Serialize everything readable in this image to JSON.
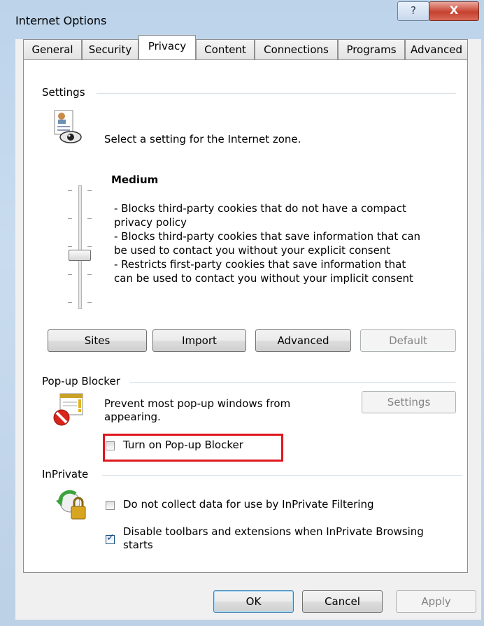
{
  "window": {
    "title": "Internet Options",
    "help_label": "?",
    "close_label": "X"
  },
  "tabs": [
    {
      "label": "General"
    },
    {
      "label": "Security"
    },
    {
      "label": "Privacy"
    },
    {
      "label": "Content"
    },
    {
      "label": "Connections"
    },
    {
      "label": "Programs"
    },
    {
      "label": "Advanced"
    }
  ],
  "active_tab": "Privacy",
  "settings": {
    "group_label": "Settings",
    "zone_text": "Select a setting for the Internet zone.",
    "level_title": "Medium",
    "level_lines": [
      "- Blocks third-party cookies that do not have a compact",
      "privacy policy",
      "- Blocks third-party cookies that save information that can",
      "be used to contact you without your explicit consent",
      "- Restricts first-party cookies that save information that",
      "can be used to contact you without your implicit consent"
    ],
    "buttons": {
      "sites": "Sites",
      "import": "Import",
      "advanced": "Advanced",
      "default": "Default"
    },
    "icon": "privacy-eye-icon"
  },
  "popup_blocker": {
    "group_label": "Pop-up Blocker",
    "description_line1": "Prevent most pop-up windows from",
    "description_line2": "appearing.",
    "settings_button": "Settings",
    "checkbox_label": "Turn on Pop-up Blocker",
    "checked": false,
    "icon": "popup-blocked-icon"
  },
  "inprivate": {
    "group_label": "InPrivate",
    "option1_label": "Do not collect data for use by InPrivate Filtering",
    "option1_checked": false,
    "option2_line1": "Disable toolbars and extensions when InPrivate Browsing",
    "option2_line2": "starts",
    "option2_checked": true,
    "icon": "inprivate-lock-icon"
  },
  "footer": {
    "ok": "OK",
    "cancel": "Cancel",
    "apply": "Apply"
  },
  "colors": {
    "highlight": "#e0161f",
    "titlebar": "#bcd3ea",
    "close_button": "#c6412f"
  }
}
